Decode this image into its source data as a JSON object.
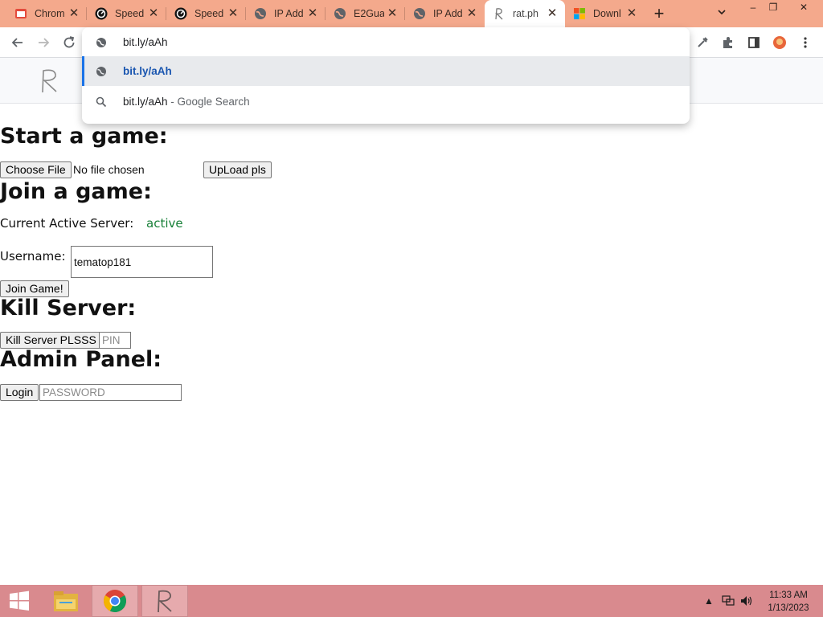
{
  "colors": {
    "tab_strip": "#f4a98c",
    "taskbar": "#d98a8e",
    "accent": "#1a73e8",
    "active_status": "#188038"
  },
  "tabs": [
    {
      "title": "Chrom",
      "icon": "chrome-icon"
    },
    {
      "title": "Speed",
      "icon": "speedometer-icon"
    },
    {
      "title": "Speed",
      "icon": "speedometer-icon"
    },
    {
      "title": "IP Add",
      "icon": "globe-icon"
    },
    {
      "title": "E2Gua",
      "icon": "globe-icon"
    },
    {
      "title": "IP Add",
      "icon": "globe-icon"
    },
    {
      "title": "rat.ph",
      "icon": "r-logo-icon",
      "active": true
    },
    {
      "title": "Downl",
      "icon": "microsoft-icon"
    }
  ],
  "window_controls": {
    "minimize": "–",
    "restore": "❐",
    "close": "✕"
  },
  "omnibox": {
    "input_value": "bit.ly/aAh",
    "suggestions": [
      {
        "text": "bit.ly/aAh",
        "suffix": "",
        "icon": "globe-icon",
        "selected": true
      },
      {
        "text": "bit.ly/aAh",
        "suffix": " - Google Search",
        "icon": "search-icon",
        "selected": false
      }
    ]
  },
  "page": {
    "start_heading": "Start a game:",
    "choose_file_button": "Choose File",
    "no_file_text": "No file chosen",
    "upload_button": "UpLoad pls",
    "join_heading": "Join a game:",
    "server_label": "Current Active Server:",
    "server_status": "active",
    "username_label": "Username:",
    "username_value": "tematop181",
    "join_button": "Join Game!",
    "kill_heading": "Kill Server:",
    "kill_button": "Kill Server PLSSS",
    "pin_placeholder": "PIN",
    "admin_heading": "Admin Panel:",
    "login_button": "Login",
    "password_placeholder": "PASSWORD"
  },
  "taskbar": {
    "time": "11:33 AM",
    "date": "1/13/2023"
  }
}
